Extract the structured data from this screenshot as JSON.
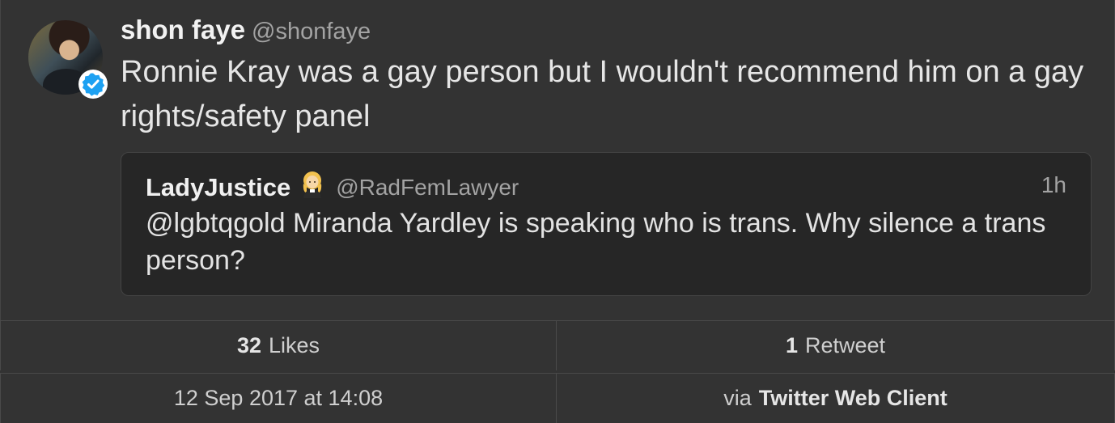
{
  "tweet": {
    "display_name": "shon faye",
    "handle": "@shonfaye",
    "text": "Ronnie Kray was a gay person but I wouldn't recommend him on a gay rights/safety panel",
    "verified": true,
    "avatar_icon": "user-avatar"
  },
  "quoted_tweet": {
    "display_name": "LadyJustice",
    "emoji": "👩‍⚖️",
    "emoji_name": "woman-judge-icon",
    "handle": "@RadFemLawyer",
    "time": "1h",
    "text": "@lgbtqgold Miranda Yardley is speaking who is trans. Why silence a trans person?"
  },
  "stats": {
    "likes_count": "32",
    "likes_label": "Likes",
    "retweets_count": "1",
    "retweets_label": "Retweet",
    "timestamp": "12 Sep 2017 at 14:08",
    "via_prefix": "via",
    "client": "Twitter Web Client"
  },
  "colors": {
    "background": "#333333",
    "verified_blue": "#1da1f2",
    "quote_background": "#262626"
  }
}
